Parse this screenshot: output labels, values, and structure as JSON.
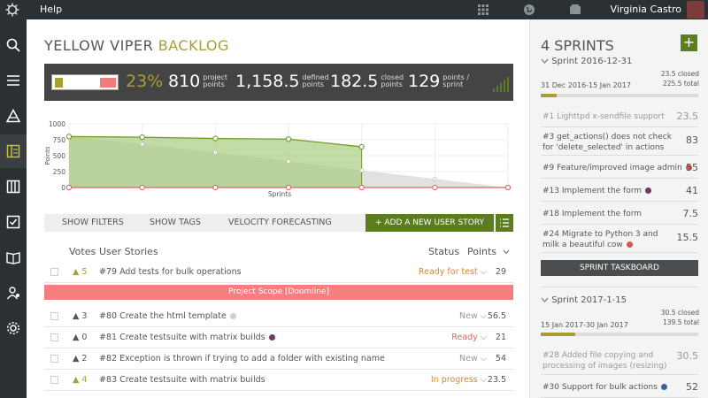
{
  "topbar": {
    "help": "Help",
    "user": "Virginia Castro"
  },
  "project": {
    "name": "YELLOW VIPER",
    "section": "BACKLOG"
  },
  "stats": {
    "percent": "23%",
    "project_points": "810",
    "project_points_label": [
      "project",
      "points"
    ],
    "defined_points": "1,158.5",
    "defined_points_label": [
      "defined",
      "points"
    ],
    "closed_points": "182.5",
    "closed_points_label": [
      "closed",
      "points"
    ],
    "points_sprint": "129",
    "points_sprint_label": [
      "points /",
      "sprint"
    ],
    "progress": {
      "closed_fraction": 0.16,
      "scope_marker_fraction": 0.7
    }
  },
  "chart_data": {
    "type": "area",
    "xlabel": "Sprints",
    "ylabel": "Points",
    "yticks": [
      "1000",
      "750",
      "500",
      "250",
      "0"
    ],
    "ylim": [
      0,
      1000
    ],
    "x": [
      0,
      1,
      2,
      3,
      4,
      5,
      6
    ],
    "series": [
      {
        "values": [
          800,
          790,
          770,
          760,
          640
        ],
        "color": "#6f9a2e"
      },
      {
        "values": [
          810,
          680,
          550,
          410,
          270,
          135,
          0
        ],
        "color": "#c8c8c8"
      },
      {
        "values": [
          0,
          0,
          0,
          0,
          0,
          0,
          0
        ],
        "color": "#e06565"
      }
    ],
    "grid": true
  },
  "filters": {
    "show_filters": "SHOW FILTERS",
    "show_tags": "SHOW TAGS",
    "velocity": "VELOCITY FORECASTING",
    "add_story": "+ ADD A NEW USER STORY"
  },
  "table": {
    "headers": {
      "votes": "Votes",
      "stories": "User Stories",
      "status": "Status",
      "points": "Points"
    },
    "rows": [
      {
        "votes": "5",
        "story": "#79 Add tests for bulk operations",
        "status": "Ready for test",
        "points": "29"
      },
      {
        "votes": "3",
        "story": "#80 Create the html template",
        "status": "New",
        "points": "56.5"
      },
      {
        "votes": "0",
        "story": "#81 Create testsuite with matrix builds",
        "status": "Ready",
        "points": "21"
      },
      {
        "votes": "2",
        "story": "#82 Exception is thrown if trying to add a folder with existing name",
        "status": "New",
        "points": "54"
      },
      {
        "votes": "4",
        "story": "#83 Create testsuite with matrix builds",
        "status": "In progress",
        "points": "23.5"
      }
    ],
    "scope_line": "Project Scope [Doomline]"
  },
  "sprints": {
    "title": "4 SPRINTS",
    "sprint1": {
      "name": "Sprint 2016-12-31",
      "dates": "31 Dec 2016-15 Jan 2017",
      "closed": "23.5 closed",
      "total": "225.5 total",
      "progress": 0.1,
      "items": [
        {
          "text": "#1 Lighttpd x-sendfile support",
          "points": "23.5"
        },
        {
          "text": "#3 get_actions() does not check for 'delete_selected' in actions",
          "points": "83"
        },
        {
          "text": "#9 Feature/improved image admin",
          "points": "55"
        },
        {
          "text": "#13 Implement the form",
          "points": "41"
        },
        {
          "text": "#18 Implement the form",
          "points": "7.5"
        },
        {
          "text": "#24 Migrate to Python 3 and milk a beautiful cow",
          "points": "15.5"
        }
      ],
      "taskboard": "SPRINT TASKBOARD"
    },
    "sprint2": {
      "name": "Sprint 2017-1-15",
      "dates": "15 Jan 2017-30 Jan 2017",
      "closed": "30.5 closed",
      "total": "139.5 total",
      "progress": 0.22,
      "items": [
        {
          "text": "#28 Added file copying and processing of images (resizing)",
          "points": "30.5"
        },
        {
          "text": "#30 Support for bulk actions",
          "points": "52"
        }
      ]
    }
  },
  "colors": {
    "accent": "#a6a032",
    "green": "#5b7d1e",
    "red": "#e06565",
    "dark": "#2b3133"
  }
}
